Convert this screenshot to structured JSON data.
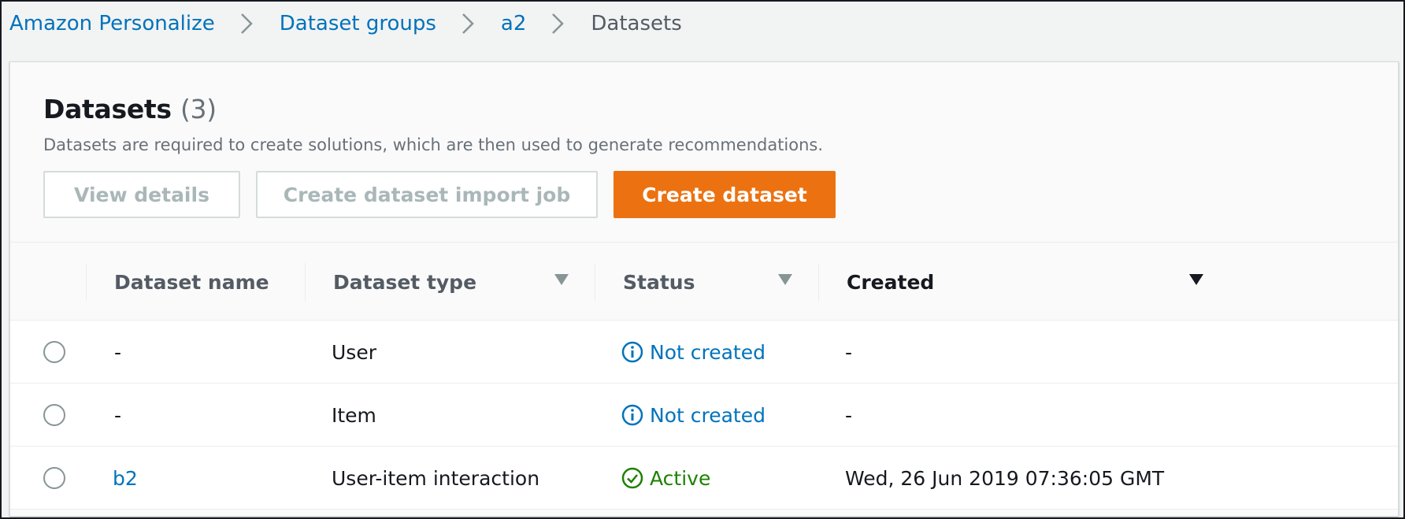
{
  "breadcrumb": {
    "items": [
      {
        "label": "Amazon Personalize"
      },
      {
        "label": "Dataset groups"
      },
      {
        "label": "a2"
      },
      {
        "label": "Datasets"
      }
    ]
  },
  "panel": {
    "title": "Datasets",
    "count": "(3)",
    "description": "Datasets are required to create solutions, which are then used to generate recommendations."
  },
  "actions": {
    "view_details": "View details",
    "create_import_job": "Create dataset import job",
    "create_dataset": "Create dataset"
  },
  "table": {
    "columns": [
      "Dataset name",
      "Dataset type",
      "Status",
      "Created"
    ],
    "rows": [
      {
        "name": "-",
        "type": "User",
        "status": "Not created",
        "created": "-"
      },
      {
        "name": "-",
        "type": "Item",
        "status": "Not created",
        "created": "-"
      },
      {
        "name": "b2",
        "type": "User-item interaction",
        "status": "Active",
        "created": "Wed, 26 Jun 2019 07:36:05 GMT"
      }
    ]
  },
  "colors": {
    "link": "#0073bb",
    "primary": "#ec7211",
    "success": "#1d8102"
  }
}
